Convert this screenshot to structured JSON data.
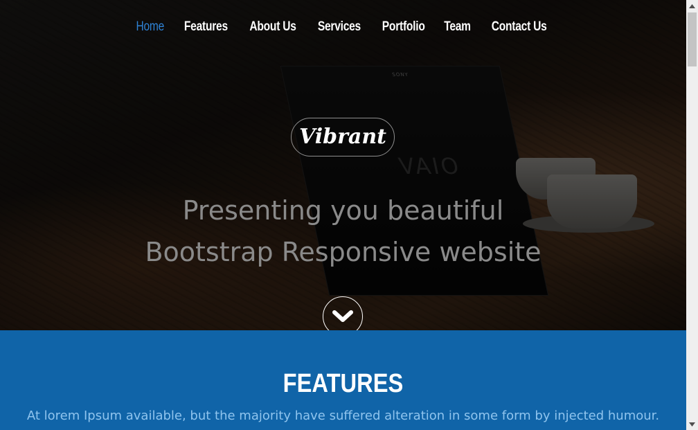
{
  "nav": {
    "items": [
      {
        "label": "Home",
        "active": true
      },
      {
        "label": "Features",
        "active": false
      },
      {
        "label": "About Us",
        "active": false
      },
      {
        "label": "Services",
        "active": false
      },
      {
        "label": "Portfolio",
        "active": false
      },
      {
        "label": "Team",
        "active": false
      },
      {
        "label": "Contact Us",
        "active": false
      }
    ]
  },
  "hero": {
    "brand": "Vibrant",
    "headline_line1": "Presenting you beautiful",
    "headline_line2": "Bootstrap Responsive website",
    "laptop_brand": "SONY",
    "laptop_logo": "VAIO",
    "scroll_icon": "chevron-down-icon"
  },
  "features": {
    "title": "FEATURES",
    "description": "At lorem Ipsum available, but the majority have suffered alteration in some form by injected humour."
  },
  "colors": {
    "accent": "#2f83d6",
    "features_bg": "#1064a8",
    "features_text": "#8fc4ee"
  }
}
